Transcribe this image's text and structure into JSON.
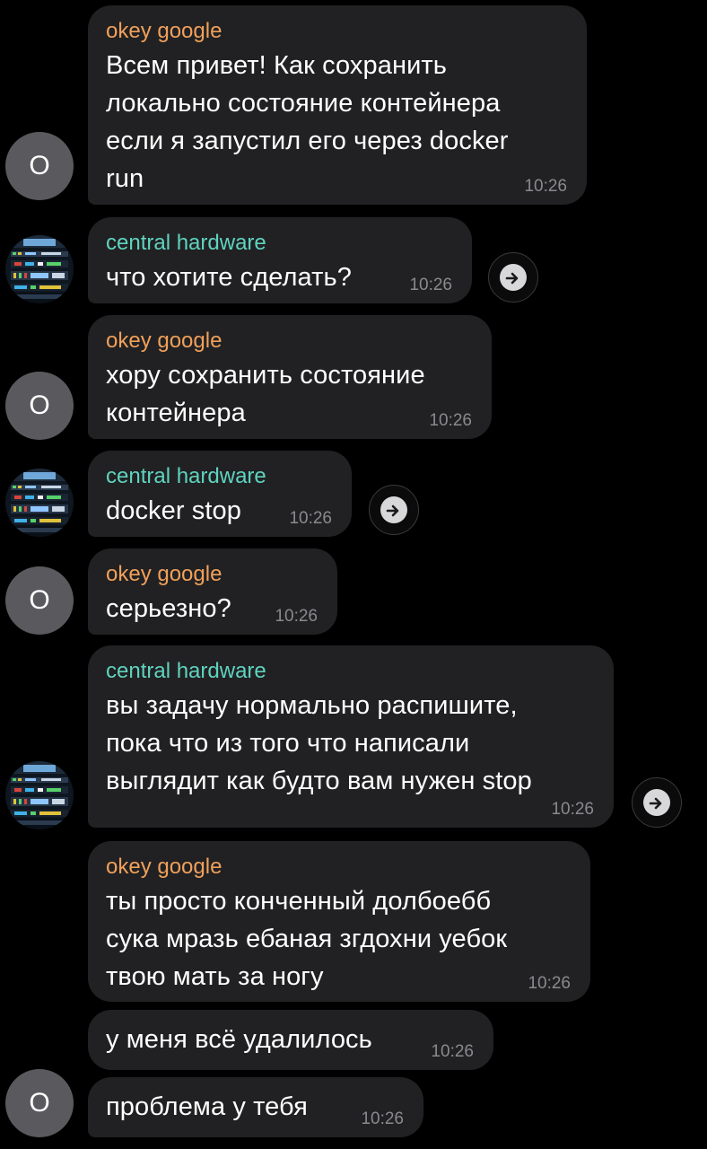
{
  "colors": {
    "background": "#000000",
    "bubble": "#212123",
    "sender_okey": "#f0a05a",
    "sender_central": "#5fd3bf",
    "time": "#8a8a8e",
    "avatar_letter_bg": "#5a5a5e"
  },
  "users": {
    "okey": {
      "name": "okey google",
      "initial": "O"
    },
    "central": {
      "name": "central hardware",
      "avatar_icon": "server-rack-photo"
    }
  },
  "messages": [
    {
      "sender": "okey google",
      "text": "Всем привет! Как сохранить\nлокально состояние контейнера\nесли я запустил его через docker\nrun",
      "time": "10:26"
    },
    {
      "sender": "central hardware",
      "text": "что хотите сделать?",
      "time": "10:26"
    },
    {
      "sender": "okey google",
      "text": "хору сохранить состояние\nконтейнера",
      "time": "10:26"
    },
    {
      "sender": "central hardware",
      "text": "docker stop",
      "time": "10:26"
    },
    {
      "sender": "okey google",
      "text": "серьезно?",
      "time": "10:26"
    },
    {
      "sender": "central hardware",
      "text": "вы задачу нормально распишите,\nпока что из того что написали\nвыглядит как будто вам нужен stop",
      "time": "10:26"
    },
    {
      "sender": "okey google",
      "text": "ты просто конченный долбоебб\nсука мразь ебаная згдохни уебок\nтвою мать за ногу",
      "time": "10:26"
    },
    {
      "sender": "",
      "text": "у меня всё удалилось",
      "time": "10:26"
    },
    {
      "sender": "",
      "text": "проблема у тебя",
      "time": "10:26"
    }
  ],
  "icons": {
    "forward": "forward-arrow-icon"
  }
}
